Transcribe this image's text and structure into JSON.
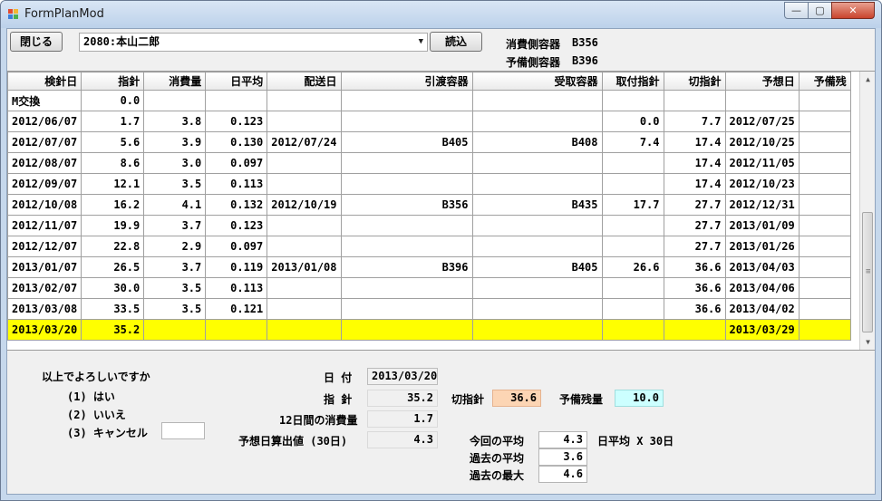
{
  "window": {
    "title": "FormPlanMod",
    "min_glyph": "—",
    "max_glyph": "▢",
    "close_glyph": "✕"
  },
  "toolbar": {
    "close_label": "閉じる",
    "customer_value": "2080:本山二郎",
    "load_label": "読込",
    "consume_container_label": "消費側容器",
    "consume_container_value": "B356",
    "spare_container_label": "予備側容器",
    "spare_container_value": "B396"
  },
  "table": {
    "columns": [
      "検針日",
      "指針",
      "消費量",
      "日平均",
      "配送日",
      "引渡容器",
      "受取容器",
      "取付指針",
      "切指針",
      "予想日",
      "予備残"
    ],
    "rows": [
      [
        "M交換",
        "0.0",
        "",
        "",
        "",
        "",
        "",
        "",
        "",
        "",
        ""
      ],
      [
        "2012/06/07",
        "1.7",
        "3.8",
        "0.123",
        "",
        "",
        "",
        "0.0",
        "7.7",
        "2012/07/25",
        ""
      ],
      [
        "2012/07/07",
        "5.6",
        "3.9",
        "0.130",
        "2012/07/24",
        "B405",
        "B408",
        "7.4",
        "17.4",
        "2012/10/25",
        ""
      ],
      [
        "2012/08/07",
        "8.6",
        "3.0",
        "0.097",
        "",
        "",
        "",
        "",
        "17.4",
        "2012/11/05",
        ""
      ],
      [
        "2012/09/07",
        "12.1",
        "3.5",
        "0.113",
        "",
        "",
        "",
        "",
        "17.4",
        "2012/10/23",
        ""
      ],
      [
        "2012/10/08",
        "16.2",
        "4.1",
        "0.132",
        "2012/10/19",
        "B356",
        "B435",
        "17.7",
        "27.7",
        "2012/12/31",
        ""
      ],
      [
        "2012/11/07",
        "19.9",
        "3.7",
        "0.123",
        "",
        "",
        "",
        "",
        "27.7",
        "2013/01/09",
        ""
      ],
      [
        "2012/12/07",
        "22.8",
        "2.9",
        "0.097",
        "",
        "",
        "",
        "",
        "27.7",
        "2013/01/26",
        ""
      ],
      [
        "2013/01/07",
        "26.5",
        "3.7",
        "0.119",
        "2013/01/08",
        "B396",
        "B405",
        "26.6",
        "36.6",
        "2013/04/03",
        ""
      ],
      [
        "2013/02/07",
        "30.0",
        "3.5",
        "0.113",
        "",
        "",
        "",
        "",
        "36.6",
        "2013/04/06",
        ""
      ],
      [
        "2013/03/08",
        "33.5",
        "3.5",
        "0.121",
        "",
        "",
        "",
        "",
        "36.6",
        "2013/04/02",
        ""
      ],
      [
        "2013/03/20",
        "35.2",
        "",
        "",
        "",
        "",
        "",
        "",
        "",
        "2013/03/29",
        ""
      ]
    ],
    "selected_row": 11
  },
  "scrollbar": {
    "up": "▲",
    "down": "▼",
    "grip": "≡"
  },
  "confirm": {
    "question": "以上でよろしいですか",
    "option1": "(1) はい",
    "option2": "(2) いいえ",
    "option3": "(3) キャンセル",
    "input_value": ""
  },
  "summary": {
    "date_label": "日 付",
    "date_value": "2013/03/20",
    "reading_label": "指 針",
    "reading_value": "35.2",
    "cut_label": "切指針",
    "cut_value": "36.6",
    "spare_label": "予備残量",
    "spare_value": "10.0",
    "usage12_label": "12日間の消費量",
    "usage12_value": "1.7",
    "calc_label": "予想日算出値 (30日)",
    "calc_value": "4.3",
    "cur_avg_label": "今回の平均",
    "cur_avg_value": "4.3",
    "unit_label": "日平均 X 30日",
    "past_avg_label": "過去の平均",
    "past_avg_value": "3.6",
    "past_max_label": "過去の最大",
    "past_max_value": "4.6"
  },
  "colors": {
    "selected_row": "#ffff00",
    "cut_field": "#fcd5b4",
    "spare_field": "#ccffff"
  }
}
